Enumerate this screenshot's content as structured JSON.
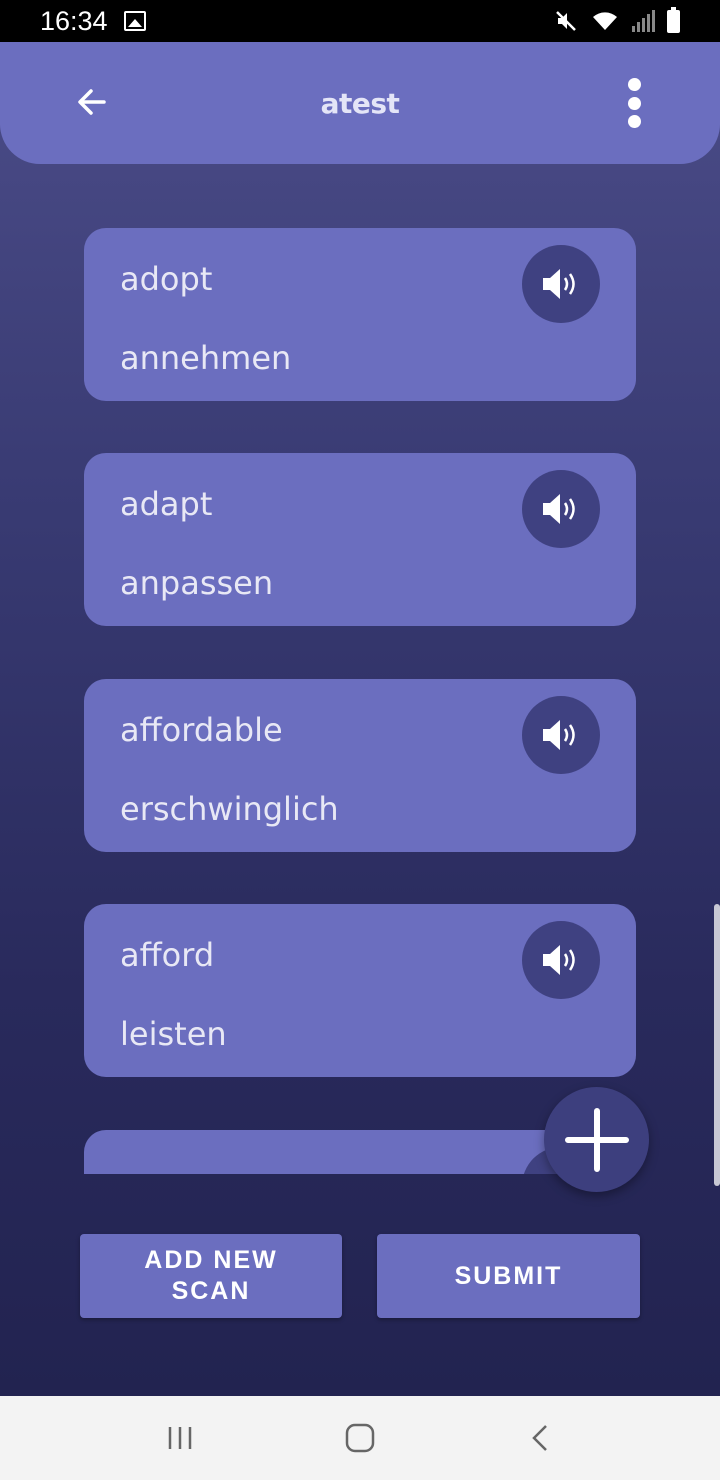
{
  "status_bar": {
    "time": "16:34",
    "icons": [
      "gallery-icon",
      "mute-icon",
      "wifi-icon",
      "signal-icon",
      "battery-icon"
    ]
  },
  "header": {
    "title": "atest",
    "back_icon": "arrow-left-icon",
    "menu_icon": "more-vertical-icon"
  },
  "words": [
    {
      "word": "adopt",
      "translation": "annehmen"
    },
    {
      "word": "adapt",
      "translation": "anpassen"
    },
    {
      "word": "affordable",
      "translation": "erschwinglich"
    },
    {
      "word": "afford",
      "translation": "leisten"
    }
  ],
  "speaker_icon": "speaker-icon",
  "fab_icon": "plus-icon",
  "buttons": {
    "add_new_scan": "ADD NEW SCAN",
    "submit": "SUBMIT"
  },
  "nav_bar": {
    "icons": [
      "recent-apps-icon",
      "home-icon",
      "back-icon"
    ]
  },
  "colors": {
    "accent": "#6b6ebf",
    "background_top": "#4b4c88",
    "background_bottom": "#222350",
    "speaker_button": "#3f4181"
  }
}
